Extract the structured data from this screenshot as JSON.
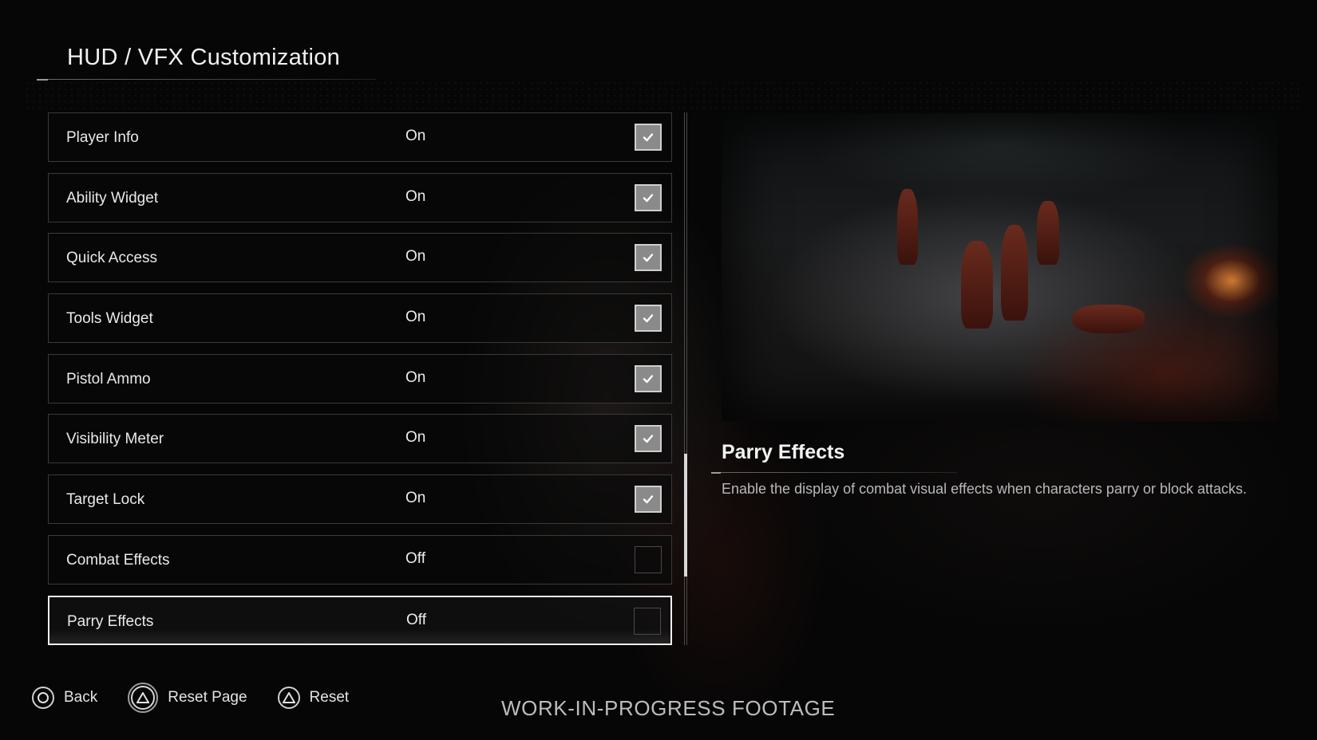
{
  "header": {
    "title": "HUD / VFX Customization"
  },
  "settings": [
    {
      "label": "Player Info",
      "value": "On",
      "checked": true
    },
    {
      "label": "Ability Widget",
      "value": "On",
      "checked": true
    },
    {
      "label": "Quick Access",
      "value": "On",
      "checked": true
    },
    {
      "label": "Tools Widget",
      "value": "On",
      "checked": true
    },
    {
      "label": "Pistol Ammo",
      "value": "On",
      "checked": true
    },
    {
      "label": "Visibility Meter",
      "value": "On",
      "checked": true
    },
    {
      "label": "Target Lock",
      "value": "On",
      "checked": true
    },
    {
      "label": "Combat Effects",
      "value": "Off",
      "checked": false
    },
    {
      "label": "Parry Effects",
      "value": "Off",
      "checked": false
    }
  ],
  "selected_index": 8,
  "description": {
    "title": "Parry Effects",
    "text": "Enable the display of combat visual effects when characters parry or block attacks."
  },
  "footer": {
    "hints": [
      {
        "icon": "circle-button-icon",
        "label": "Back"
      },
      {
        "icon": "triangle-button-icon",
        "label": "Reset Page"
      },
      {
        "icon": "triangle-button-icon",
        "label": "Reset"
      }
    ],
    "watermark": "WORK-IN-PROGRESS FOOTAGE"
  },
  "colors": {
    "background": "#050505",
    "text": "#e6e6e6",
    "checkbox_fill": "#8a8a8a",
    "selected_border": "#efefef"
  }
}
